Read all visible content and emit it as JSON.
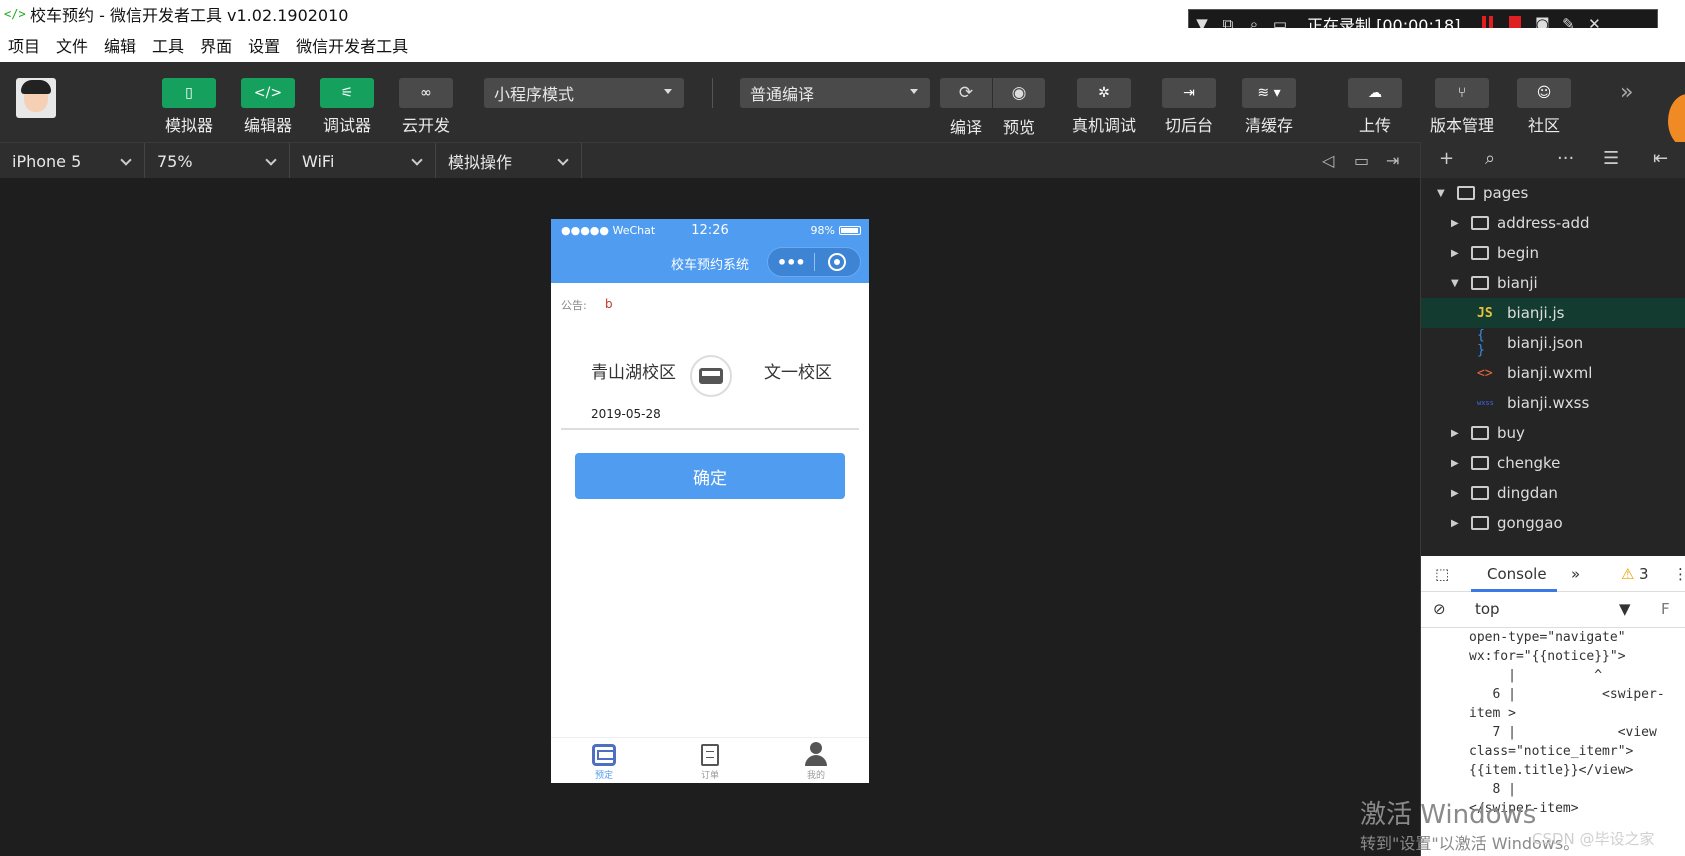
{
  "window": {
    "title": "校车预约 - 微信开发者工具 v1.02.1902010",
    "app_icon": "</>"
  },
  "recorder": {
    "status": "正在录制 [00:00:18]"
  },
  "menu": [
    "项目",
    "文件",
    "编辑",
    "工具",
    "界面",
    "设置",
    "微信开发者工具"
  ],
  "toolbar": {
    "simulator": "模拟器",
    "editor": "编辑器",
    "debugger": "调试器",
    "cloud": "云开发",
    "mode": "小程序模式",
    "compile_mode": "普通编译",
    "compile": "编译",
    "preview": "预览",
    "remote_debug": "真机调试",
    "background": "切后台",
    "clear_cache": "清缓存",
    "upload": "上传",
    "version": "版本管理",
    "community": "社区"
  },
  "devbar": {
    "device": "iPhone 5",
    "zoom": "75%",
    "network": "WiFi",
    "operation": "模拟操作"
  },
  "phone": {
    "status": {
      "carrier": "●●●●● WeChat",
      "time": "12:26",
      "battery": "98%"
    },
    "nav_title": "校车预约系统",
    "notice_label": "公告:",
    "notice_value": "b",
    "from_campus": "青山湖校区",
    "to_campus": "文一校区",
    "date": "2019-05-28",
    "confirm": "确定",
    "tabs": [
      "预定",
      "订单",
      "我的"
    ]
  },
  "file_tree": [
    {
      "name": "pages",
      "type": "folder",
      "open": true,
      "depth": 0
    },
    {
      "name": "address-add",
      "type": "folder",
      "open": false,
      "depth": 1
    },
    {
      "name": "begin",
      "type": "folder",
      "open": false,
      "depth": 1
    },
    {
      "name": "bianji",
      "type": "folder",
      "open": true,
      "depth": 1
    },
    {
      "name": "bianji.js",
      "type": "js",
      "depth": 2,
      "selected": true
    },
    {
      "name": "bianji.json",
      "type": "json",
      "depth": 2
    },
    {
      "name": "bianji.wxml",
      "type": "wxml",
      "depth": 2
    },
    {
      "name": "bianji.wxss",
      "type": "wxss",
      "depth": 2
    },
    {
      "name": "buy",
      "type": "folder",
      "open": false,
      "depth": 1
    },
    {
      "name": "chengke",
      "type": "folder",
      "open": false,
      "depth": 1
    },
    {
      "name": "dingdan",
      "type": "folder",
      "open": false,
      "depth": 1
    },
    {
      "name": "gonggao",
      "type": "folder",
      "open": false,
      "depth": 1
    }
  ],
  "console": {
    "tab": "Console",
    "warnings": "3",
    "context": "top",
    "filter_placeholder": "F",
    "lines": [
      "open-type=\"navigate\"",
      "wx:for=\"{{notice}}\">",
      "     |          ^",
      "   6 |           <swiper-",
      "item >",
      "   7 |             <view",
      "class=\"notice_itemr\">",
      "{{item.title}}</view>",
      "   8 |",
      "</swiper-item>"
    ]
  },
  "watermark": {
    "line1": "激活 Windows",
    "line2": "转到\"设置\"以激活 Windows。",
    "csdn": "CSDN @毕设之家"
  }
}
